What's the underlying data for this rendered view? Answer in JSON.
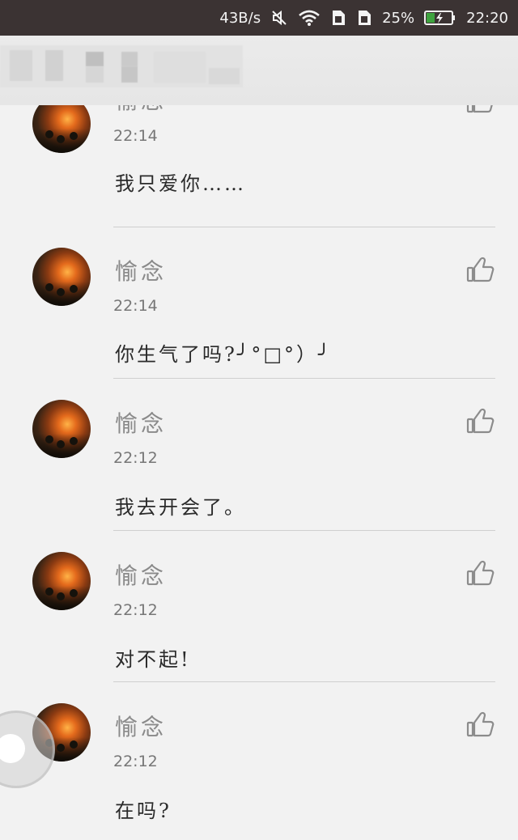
{
  "status_bar": {
    "speed": "43B/s",
    "battery_percent": "25%",
    "time": "22:20",
    "icons": [
      "mute-icon",
      "wifi-icon",
      "sim-card-icon",
      "sim-card-icon",
      "battery-charging-icon"
    ]
  },
  "comments": [
    {
      "user": "愉念",
      "time": "22:14",
      "text": "我只爱你……"
    },
    {
      "user": "愉念",
      "time": "22:14",
      "text": "你生气了吗?╯°□°）╯"
    },
    {
      "user": "愉念",
      "time": "22:12",
      "text": "我去开会了。"
    },
    {
      "user": "愉念",
      "time": "22:12",
      "text": "对不起!"
    },
    {
      "user": "愉念",
      "time": "22:12",
      "text": "在吗?"
    }
  ],
  "like_icon": "thumbs-up-icon"
}
